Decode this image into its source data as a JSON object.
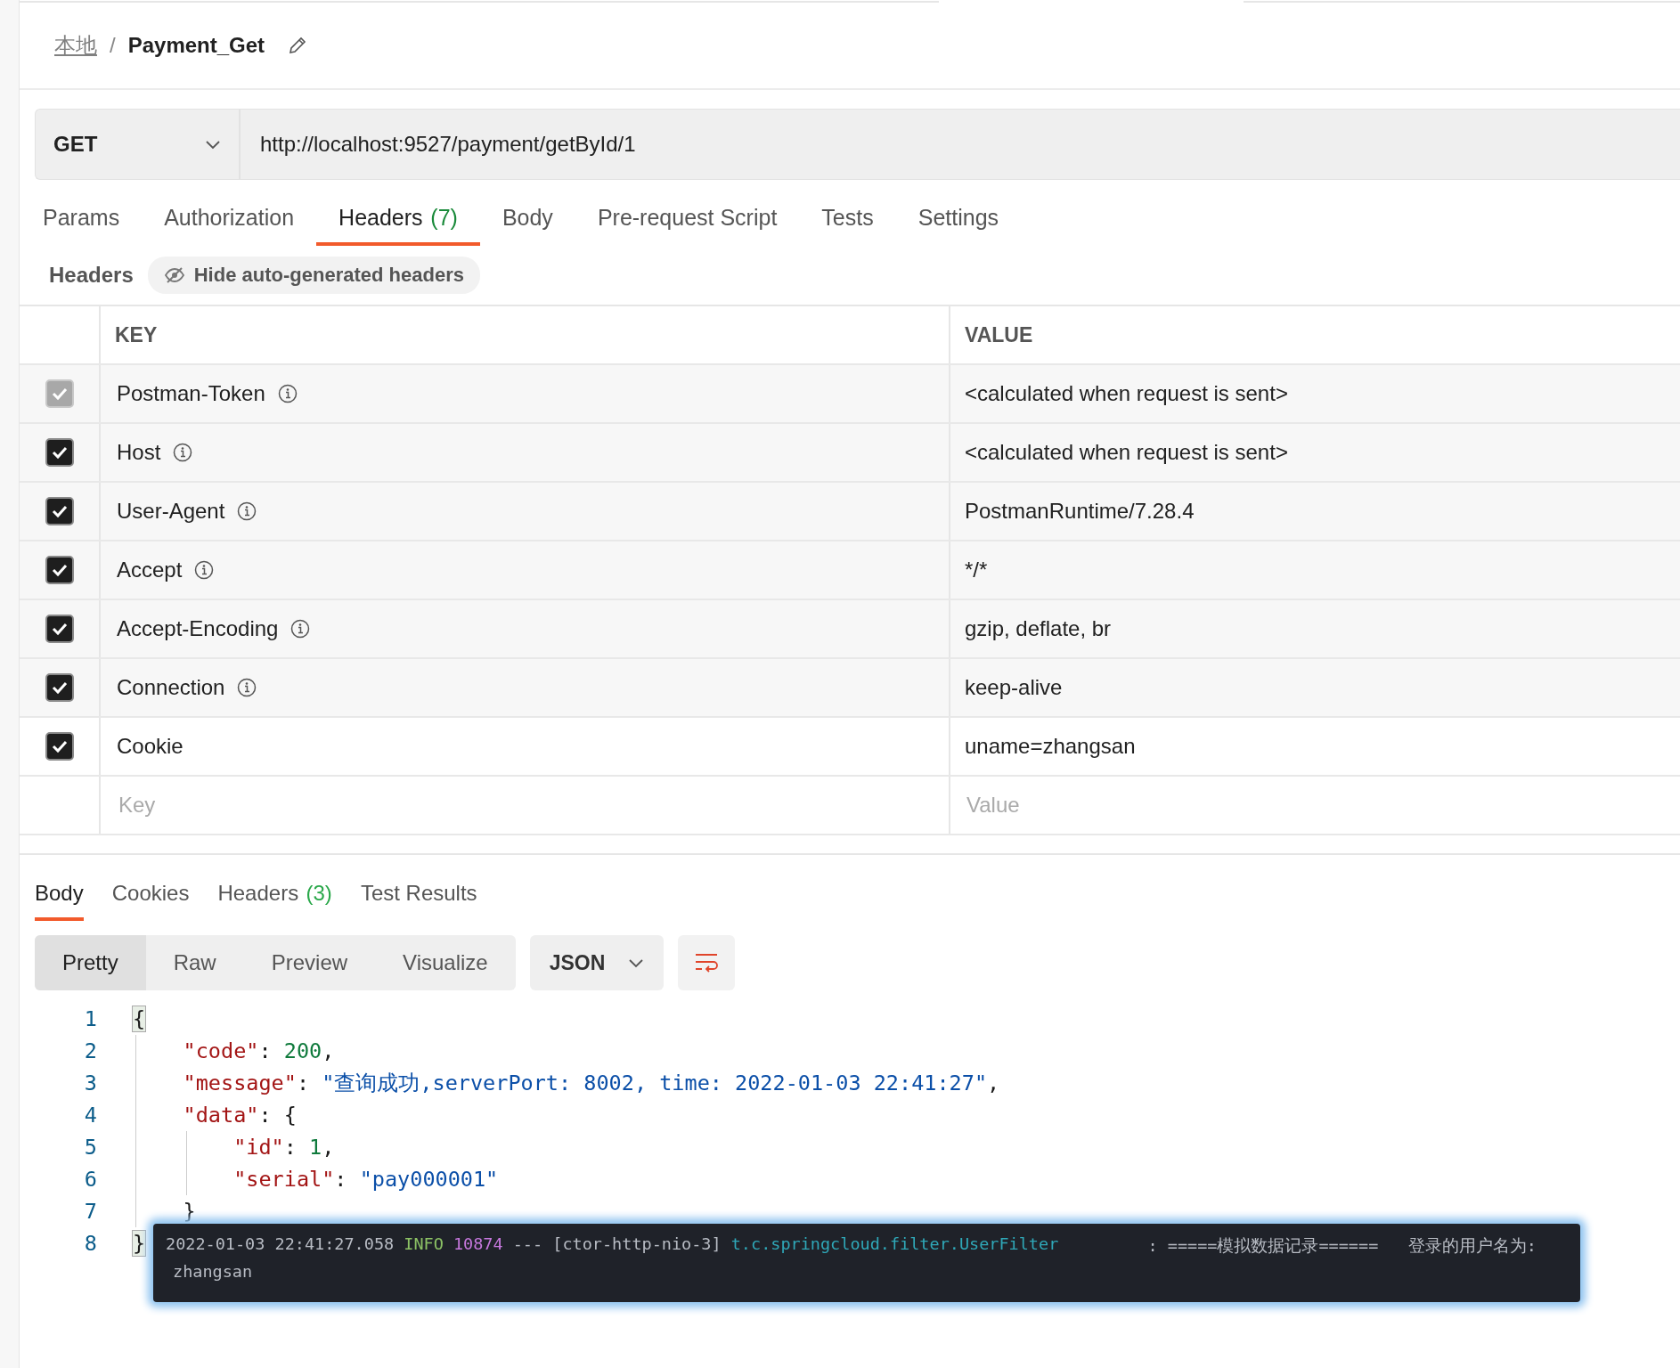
{
  "breadcrumb": {
    "parent": "本地",
    "separator": "/",
    "name": "Payment_Get"
  },
  "request": {
    "method": "GET",
    "url": "http://localhost:9527/payment/getById/1"
  },
  "request_tabs": [
    {
      "label": "Params",
      "selected": false
    },
    {
      "label": "Authorization",
      "selected": false
    },
    {
      "label": "Headers",
      "count": "(7)",
      "selected": true
    },
    {
      "label": "Body",
      "selected": false
    },
    {
      "label": "Pre-request Script",
      "selected": false
    },
    {
      "label": "Tests",
      "selected": false
    },
    {
      "label": "Settings",
      "selected": false
    }
  ],
  "headers_section": {
    "title": "Headers",
    "toggle": "Hide auto-generated headers"
  },
  "headers_table": {
    "columns": [
      "KEY",
      "VALUE"
    ],
    "rows": [
      {
        "key": "Postman-Token",
        "value": "<calculated when request is sent>",
        "checked": true,
        "disabled": true,
        "auto_generated": true
      },
      {
        "key": "Host",
        "value": "<calculated when request is sent>",
        "checked": true,
        "disabled": false,
        "auto_generated": true
      },
      {
        "key": "User-Agent",
        "value": "PostmanRuntime/7.28.4",
        "checked": true,
        "disabled": false,
        "auto_generated": true
      },
      {
        "key": "Accept",
        "value": "*/*",
        "checked": true,
        "disabled": false,
        "auto_generated": true
      },
      {
        "key": "Accept-Encoding",
        "value": "gzip, deflate, br",
        "checked": true,
        "disabled": false,
        "auto_generated": true
      },
      {
        "key": "Connection",
        "value": "keep-alive",
        "checked": true,
        "disabled": false,
        "auto_generated": true
      },
      {
        "key": "Cookie",
        "value": "uname=zhangsan",
        "checked": true,
        "disabled": false,
        "auto_generated": false
      }
    ],
    "new_row": {
      "key_placeholder": "Key",
      "value_placeholder": "Value"
    }
  },
  "response_tabs": [
    {
      "label": "Body",
      "selected": true
    },
    {
      "label": "Cookies",
      "selected": false
    },
    {
      "label": "Headers",
      "count": "(3)",
      "selected": false
    },
    {
      "label": "Test Results",
      "selected": false
    }
  ],
  "view_modes": [
    {
      "label": "Pretty",
      "selected": true
    },
    {
      "label": "Raw",
      "selected": false
    },
    {
      "label": "Preview",
      "selected": false
    },
    {
      "label": "Visualize",
      "selected": false
    }
  ],
  "format": "JSON",
  "code": [
    {
      "number": "1",
      "tokens": [
        {
          "kind": "punct",
          "text": "{",
          "matched": true
        }
      ]
    },
    {
      "number": "2",
      "tokens": [
        {
          "kind": "key",
          "text": "    \"code\""
        },
        {
          "kind": "punct",
          "text": ": "
        },
        {
          "kind": "number",
          "text": "200"
        },
        {
          "kind": "punct",
          "text": ","
        }
      ]
    },
    {
      "number": "3",
      "tokens": [
        {
          "kind": "key",
          "text": "    \"message\""
        },
        {
          "kind": "punct",
          "text": ": "
        },
        {
          "kind": "string",
          "text": "\"查询成功,serverPort: 8002, time: 2022-01-03 22:41:27\""
        },
        {
          "kind": "punct",
          "text": ","
        }
      ]
    },
    {
      "number": "4",
      "tokens": [
        {
          "kind": "key",
          "text": "    \"data\""
        },
        {
          "kind": "punct",
          "text": ": {"
        }
      ]
    },
    {
      "number": "5",
      "tokens": [
        {
          "kind": "key",
          "text": "        \"id\""
        },
        {
          "kind": "punct",
          "text": ": "
        },
        {
          "kind": "number",
          "text": "1"
        },
        {
          "kind": "punct",
          "text": ","
        }
      ]
    },
    {
      "number": "6",
      "tokens": [
        {
          "kind": "key",
          "text": "        \"serial\""
        },
        {
          "kind": "punct",
          "text": ": "
        },
        {
          "kind": "string",
          "text": "\"pay000001\""
        }
      ]
    },
    {
      "number": "7",
      "tokens": [
        {
          "kind": "punct",
          "text": "    }"
        }
      ]
    },
    {
      "number": "8",
      "tokens": [
        {
          "kind": "punct",
          "text": "}",
          "matched": true
        }
      ]
    }
  ],
  "log_popup": {
    "lines": [
      [
        {
          "text": "2022-01-03 22:41:27.058",
          "color": "#b8bcc4"
        },
        {
          "text": "INFO",
          "color": "#8cc265"
        },
        {
          "text": "10874",
          "color": "#c678dd"
        },
        {
          "text": "--- [ctor-http-nio-3]",
          "color": "#b8bcc4"
        },
        {
          "text": "t.c.springcloud.filter.UserFilter",
          "color": "#2fa8b8"
        },
        {
          "text": "        : =====模拟数据记录======   登录的用户名为:",
          "color": "#b8bcc4"
        }
      ],
      [
        {
          "text": "zhangsan",
          "color": "#b8bcc4"
        }
      ]
    ]
  }
}
